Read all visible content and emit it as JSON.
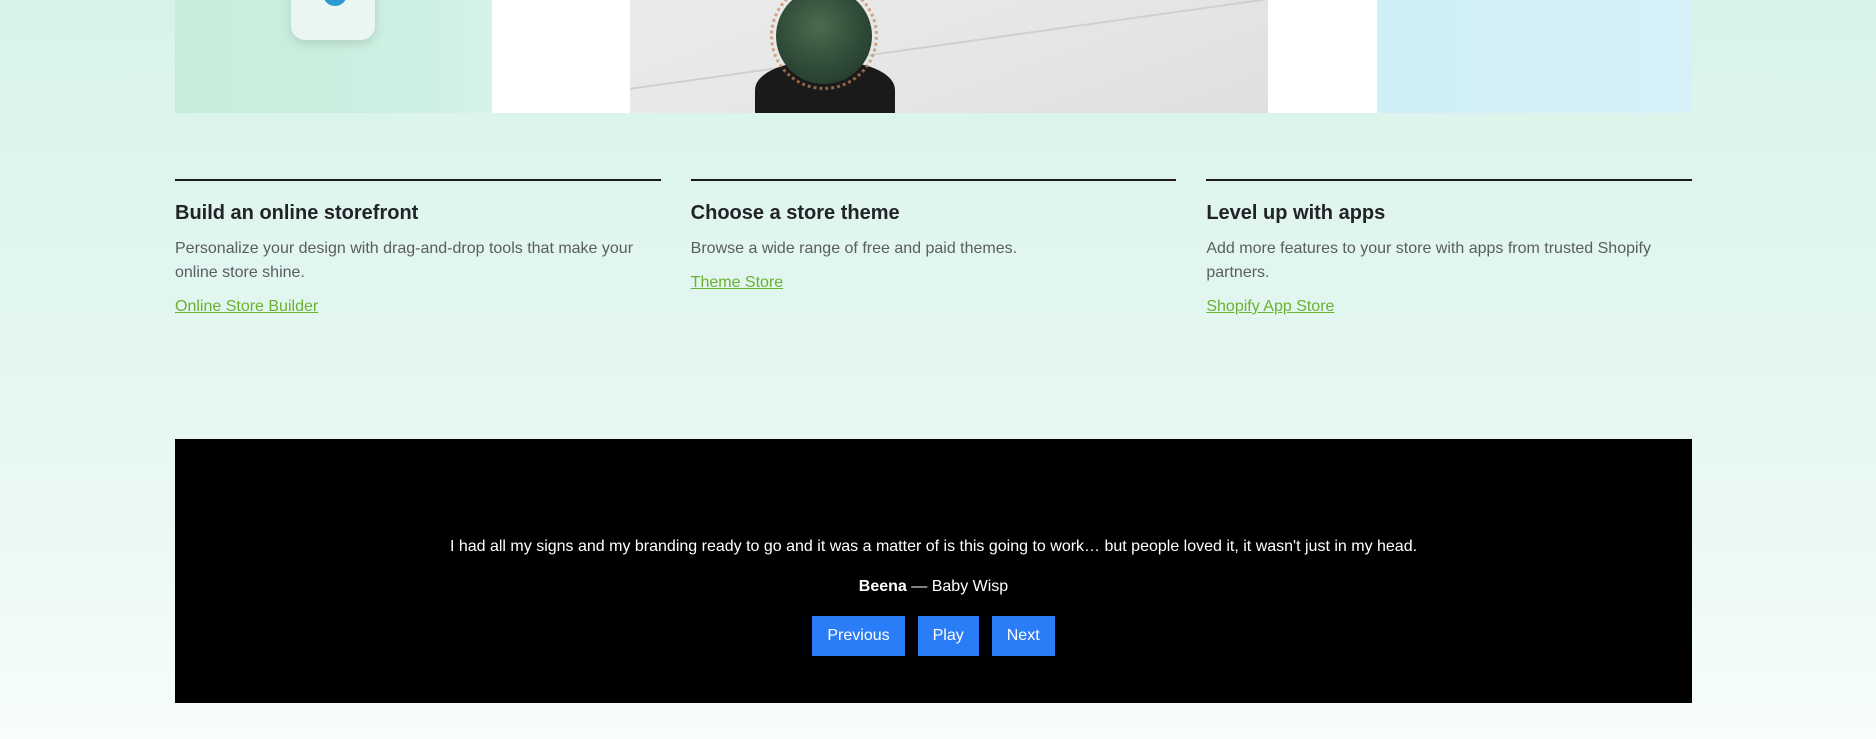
{
  "features": [
    {
      "title": "Build an online storefront",
      "description": "Personalize your design with drag-and-drop tools that make your online store shine.",
      "link": "Online Store Builder"
    },
    {
      "title": "Choose a store theme",
      "description": "Browse a wide range of free and paid themes.",
      "link": "Theme Store"
    },
    {
      "title": "Level up with apps",
      "description": "Add more features to your store with apps from trusted Shopify partners.",
      "link": "Shopify App Store"
    }
  ],
  "testimonial": {
    "quote": "I had all my signs and my branding ready to go and it was a matter of is this going to work… but people loved it, it wasn't just in my head.",
    "author": "Beena",
    "separator": " — ",
    "company": "Baby Wisp",
    "controls": {
      "previous": "Previous",
      "play": "Play",
      "next": "Next"
    }
  },
  "colors": {
    "link": "#6bb130",
    "button": "#2b7cf7",
    "testimonial_bg": "#000000"
  },
  "icons": {
    "app_tile": "app-icon-tile",
    "photo": "cactus-photo"
  }
}
